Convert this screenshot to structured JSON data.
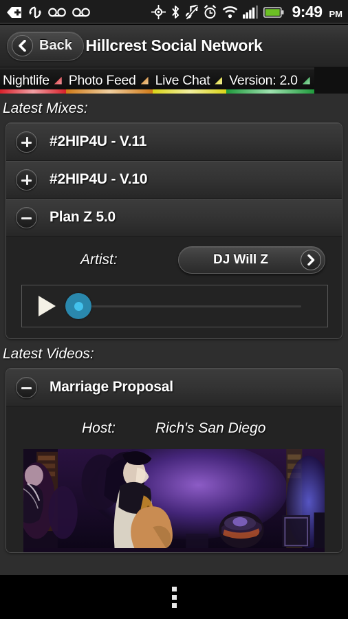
{
  "statusbar": {
    "icons": [
      {
        "name": "sd-card-add-icon"
      },
      {
        "name": "sync-icon"
      },
      {
        "name": "voicemail-icon"
      },
      {
        "name": "voicemail-icon"
      },
      {
        "name": "gps-location-icon"
      },
      {
        "name": "bluetooth-icon"
      },
      {
        "name": "music-muted-icon"
      },
      {
        "name": "alarm-clock-icon"
      },
      {
        "name": "wifi-icon"
      },
      {
        "name": "signal-bars-icon"
      },
      {
        "name": "battery-icon"
      }
    ],
    "time": "9:49",
    "ampm": "PM",
    "battery_color": "#6cc024"
  },
  "titlebar": {
    "back_label": "Back",
    "title": "Hillcrest Social Network"
  },
  "tabs": [
    {
      "label": "Nightlife",
      "color": "#d8202a",
      "underline_mid": "#f0a0a4"
    },
    {
      "label": "Photo Feed",
      "color": "#d07a18",
      "underline_mid": "#f0cfa0"
    },
    {
      "label": "Live Chat",
      "color": "#d9d418",
      "underline_mid": "#f2efa0"
    },
    {
      "label": "Version: 2.0",
      "color": "#1f9a3c",
      "underline_mid": "#9fe2b0"
    }
  ],
  "mixes": {
    "section_title": "Latest Mixes:",
    "rows": [
      {
        "label": "#2HIP4U - V.11",
        "state": "collapsed",
        "icon": "plus-icon"
      },
      {
        "label": "#2HIP4U - V.10",
        "state": "collapsed",
        "icon": "plus-icon"
      },
      {
        "label": "Plan Z 5.0",
        "state": "expanded",
        "icon": "minus-icon"
      }
    ],
    "expanded": {
      "artist_label": "Artist:",
      "artist_value": "DJ Will Z",
      "player": {
        "play_icon": "play-icon",
        "progress_percent": 0,
        "knob_color": "#2a88ad",
        "knob_inner_color": "#43c2ed"
      }
    }
  },
  "videos": {
    "section_title": "Latest Videos:",
    "rows": [
      {
        "label": "Marriage Proposal",
        "state": "expanded",
        "icon": "minus-icon"
      }
    ],
    "expanded": {
      "host_label": "Host:",
      "host_value": "Rich's San Diego",
      "thumbnail_name": "video-thumbnail-nightclub"
    }
  },
  "navbar": {
    "overflow_name": "overflow-menu-button"
  }
}
